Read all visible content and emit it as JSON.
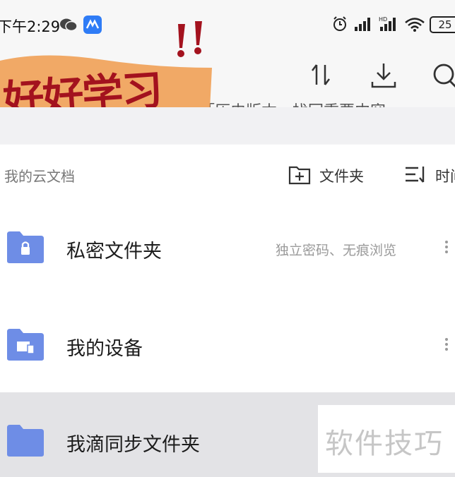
{
  "status_bar": {
    "time": "下午2:29",
    "battery": "25",
    "icons": [
      "wechat-icon",
      "app-icon",
      "alarm-icon",
      "signal-icon",
      "hd-signal-icon",
      "wifi-icon",
      "battery-icon"
    ]
  },
  "toolbar": {
    "sticker_text": "好好学习",
    "history_tip": "「历史版本」找回重要内容",
    "icons": [
      "sort-swap-icon",
      "download-icon",
      "search-icon"
    ]
  },
  "section": {
    "title": "我的云文档",
    "new_folder_label": "文件夹",
    "sort_label": "时间"
  },
  "folders": [
    {
      "name": "私密文件夹",
      "desc": "独立密码、无痕浏览",
      "icon": "lock-folder-icon"
    },
    {
      "name": "我的设备",
      "desc": "",
      "icon": "device-folder-icon"
    },
    {
      "name": "我滴同步文件夹",
      "desc": "",
      "icon": "folder-icon"
    }
  ],
  "watermark": "软件技巧",
  "colors": {
    "folder": "#6e8de6",
    "sticker": "#f0a055",
    "sticker_text": "#a3121e"
  }
}
